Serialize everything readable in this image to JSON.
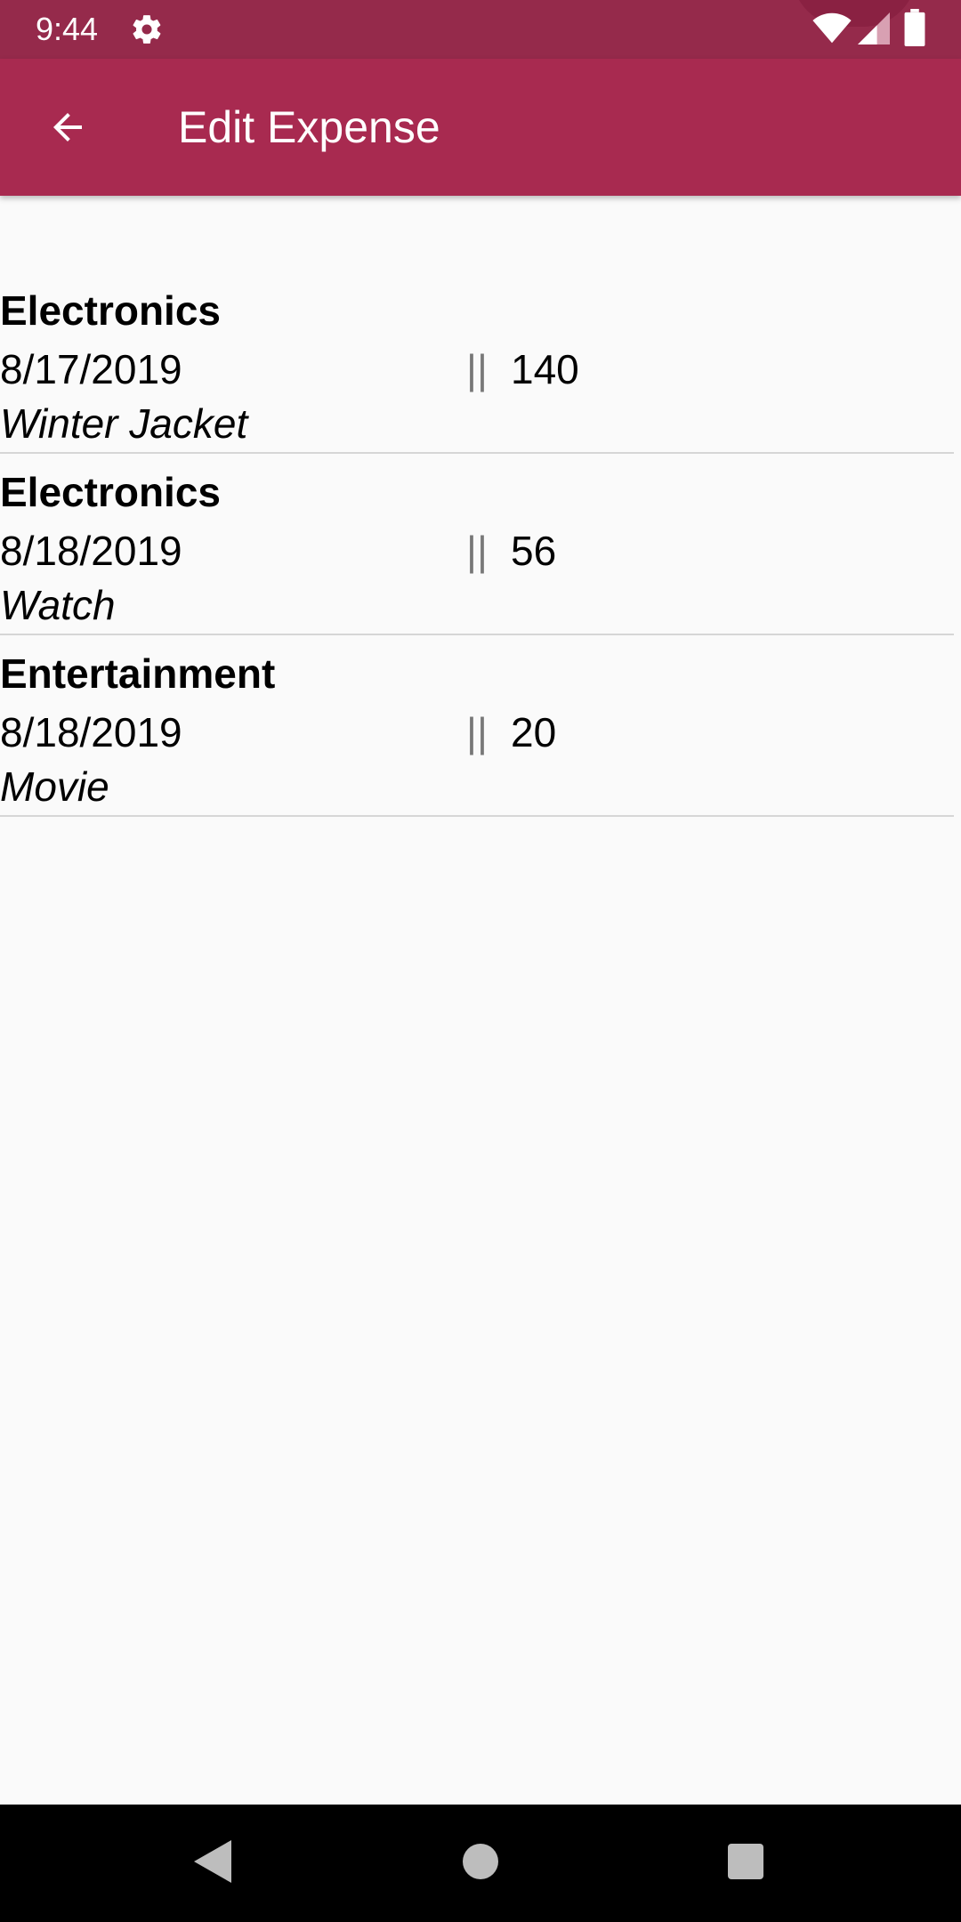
{
  "status_bar": {
    "time": "9:44",
    "icons": [
      "gear-icon",
      "wifi-icon",
      "signal-icon",
      "battery-icon"
    ]
  },
  "app_bar": {
    "title": "Edit Expense",
    "back_icon": "arrow-back-icon",
    "background": "#a82a50"
  },
  "expenses": [
    {
      "category": "Electronics",
      "date": "8/17/2019",
      "separator": "||",
      "amount": "140",
      "note": "Winter Jacket"
    },
    {
      "category": "Electronics",
      "date": "8/18/2019",
      "separator": "||",
      "amount": "56",
      "note": "Watch"
    },
    {
      "category": "Entertainment",
      "date": "8/18/2019",
      "separator": "||",
      "amount": "20",
      "note": "Movie"
    }
  ],
  "nav_bar": {
    "icons": [
      "nav-back-icon",
      "nav-home-icon",
      "nav-recents-icon"
    ]
  }
}
